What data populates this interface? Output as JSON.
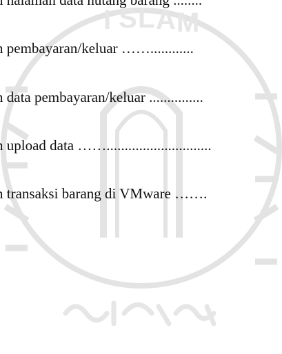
{
  "watermark": {
    "emblem": "islamic-university-of-indonesia-seal",
    "arc_text": "ISLAM INDONESIA UNIVERSITAS",
    "script_text": "arabic calligraphy",
    "color": "#e3e3e3"
  },
  "toc": {
    "lines": [
      {
        "text": "n halaman data hutang barang ........"
      },
      {
        "text": "n pembayaran/keluar ……............"
      },
      {
        "text": "n data pembayaran/keluar ..............."
      },
      {
        "text": "n upload data ……............................."
      },
      {
        "text": "n transaksi barang di VMware ……."
      }
    ]
  }
}
